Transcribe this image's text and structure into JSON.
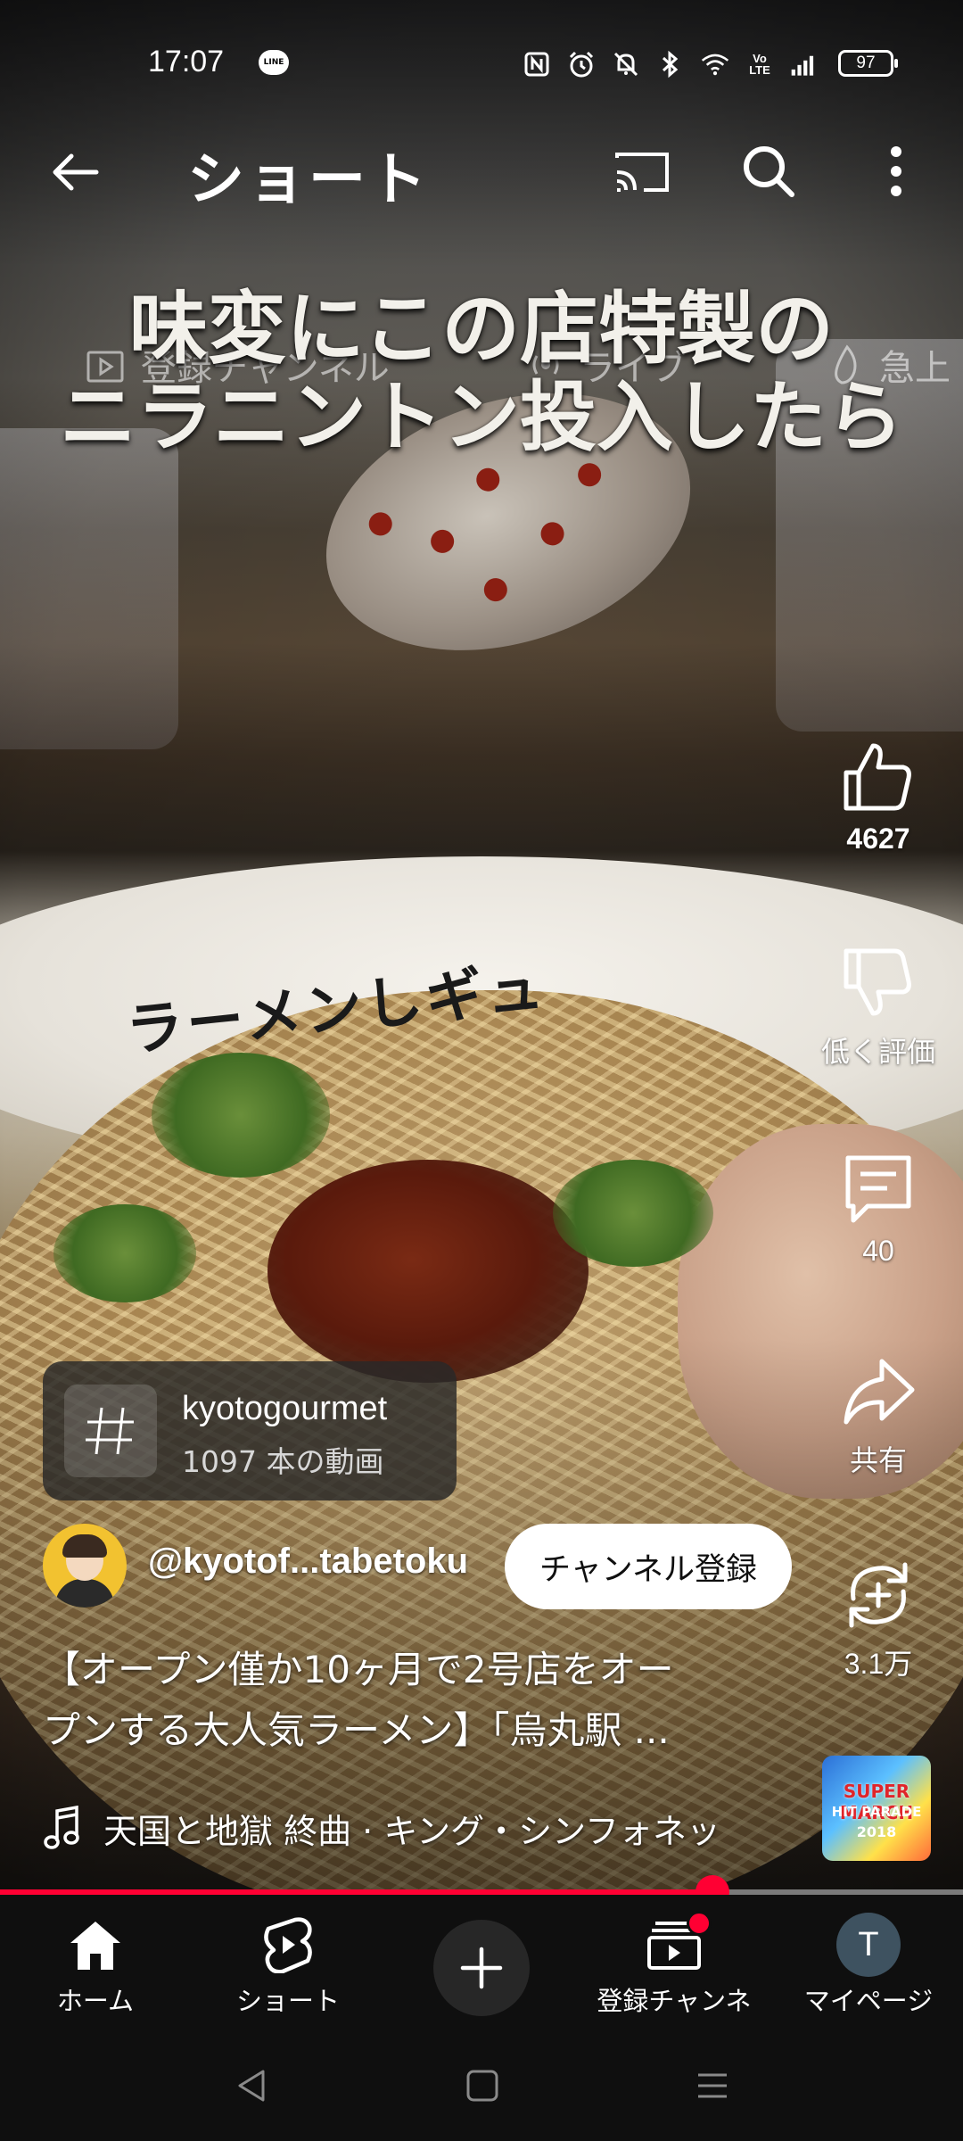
{
  "status_bar": {
    "time": "17:07",
    "notification_app": "LINE",
    "battery": "97",
    "icons": [
      "nfc-icon",
      "alarm-icon",
      "mute-icon",
      "bluetooth-icon",
      "wifi-icon",
      "volte-icon",
      "signal-icon",
      "battery-icon"
    ],
    "volte_label": "Vo\nLTE"
  },
  "header": {
    "title": "ショート"
  },
  "feed_chips": [
    {
      "label": "登録チャンネル",
      "icon": "subscriptions-icon"
    },
    {
      "label": "ライブ",
      "icon": "live-icon"
    },
    {
      "label": "急上",
      "icon": "trending-icon"
    }
  ],
  "video": {
    "caption_line1": "味変にこの店特製の",
    "caption_line2": "ニラニントン投入したら",
    "bowl_text": "ラーメンしギュ"
  },
  "actions": {
    "like_count": "4627",
    "dislike_label": "低く評価",
    "comment_count": "40",
    "share_label": "共有",
    "remix_count": "3.1万"
  },
  "hashtag": {
    "name": "kyotogourmet",
    "count": "1097 本の動画"
  },
  "channel": {
    "handle": "@kyotof...tabetoku",
    "subscribe_label": "チャンネル登録"
  },
  "title": {
    "line1": "【オープン僅か10ヶ月で2号店をオー",
    "line2": "プンする大人気ラーメン】「烏丸駅 ..."
  },
  "music": {
    "text": "天国と地獄 終曲 · キング・シンフォネッ",
    "thumb_line1": "SUPER MARCH",
    "thumb_line2": "HIT PARADE",
    "thumb_line3": "2018"
  },
  "progress": {
    "fraction": 0.74
  },
  "bottom_nav": {
    "home": "ホーム",
    "shorts": "ショート",
    "subscriptions": "登録チャンネル",
    "mypage": "マイページ",
    "avatar_initial": "T"
  },
  "colors": {
    "accent_red": "#ff0033",
    "nav_background": "#0f0f0f",
    "avatar_bg": "#3e5260"
  }
}
